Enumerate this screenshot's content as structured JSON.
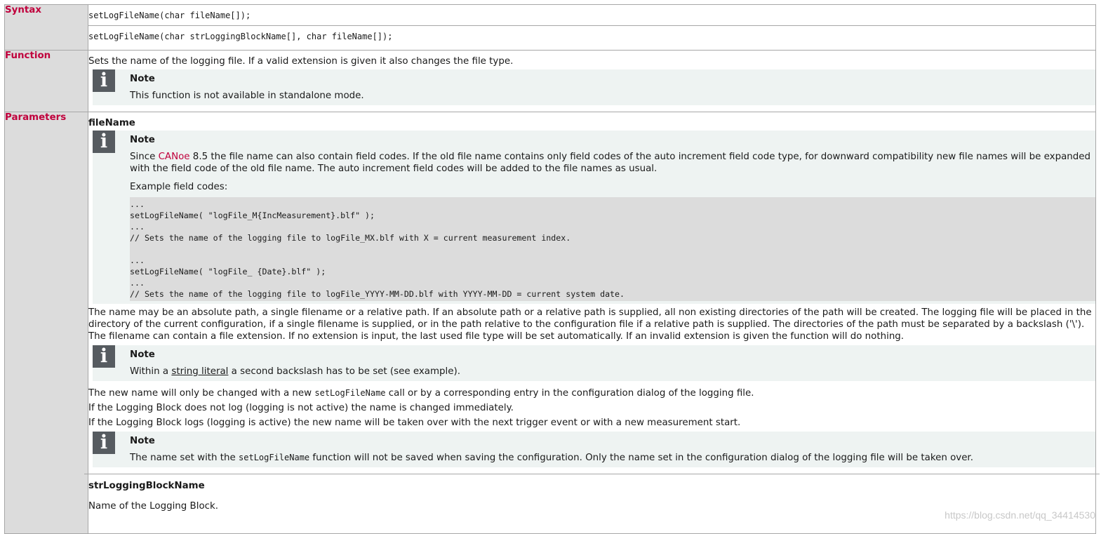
{
  "rows": {
    "syntax": {
      "label": "Syntax",
      "line1": "setLogFileName(char fileName[]);",
      "line2": "setLogFileName(char strLoggingBlockName[], char fileName[]);"
    },
    "function": {
      "label": "Function",
      "text": "Sets the name of the logging file. If a valid extension is given it also changes the file type.",
      "note_title": "Note",
      "note_text": "This function is not available in standalone mode."
    },
    "parameters": {
      "label": "Parameters",
      "param1_name": "fileName",
      "note1_title": "Note",
      "note1_text_prefix": "Since ",
      "note1_canoe": "CANoe",
      "note1_text_suffix": " 8.5 the file name can also contain field codes. If the old file name contains only field codes of the auto increment field code type, for downward compatibility new file names will be expanded with the field code of the old file name. The auto increment field codes will be added to the file names as usual.",
      "note1_example_label": "Example field codes:",
      "code_lines": [
        "...",
        "setLogFileName( \"logFile_M{IncMeasurement}.blf\" );",
        "...",
        "// Sets the name of the logging file to logFile_MX.blf with X = current measurement index.",
        "",
        "...",
        "setLogFileName( \"logFile_ {Date}.blf\" );",
        "...",
        "// Sets the name of the logging file to logFile_YYYY-MM-DD.blf with YYYY-MM-DD = current system date."
      ],
      "path_text": "The name may be an absolute path, a single filename or a relative path. If an absolute path or a relative path is supplied, all non existing directories of the path will be created. The logging file will be placed in the directory of the current configuration, if a single filename is supplied, or in the path relative to the configuration file if a relative path is supplied. The directories of the path must be separated by a backslash ('\\'). The filename can contain a file extension. If no extension is input, the last used file type will be set automatically. If an invalid extension is given the function will do nothing.",
      "note2_title": "Note",
      "note2_prefix": "Within a ",
      "note2_link": "string literal",
      "note2_suffix": " a second backslash has to be set (see example).",
      "change_prefix": "The new name will only be changed with a new ",
      "change_code": "setLogFileName",
      "change_suffix": " call or by a corresponding entry in the configuration dialog of the logging file.",
      "not_active_text": "If the Logging Block does not log (logging is not active) the name is changed immediately.",
      "active_text": "If the Logging Block logs (logging is active) the new name will be taken over with the next trigger event or with a new measurement start.",
      "note3_title": "Note",
      "note3_prefix": "The name set with the ",
      "note3_code": "setLogFileName",
      "note3_suffix": " function will not be saved when saving the configuration. Only the name set in the configuration dialog of the logging file will be taken over.",
      "param2_name": "strLoggingBlockName",
      "param2_desc": "Name of the Logging Block."
    }
  },
  "icons": {
    "info": "i"
  },
  "watermark": "https://blog.csdn.net/qq_34414530",
  "colors": {
    "accent": "#c0003c",
    "label_bg": "#dcdcdc",
    "note_bg": "#eef3f2",
    "icon_bg": "#565b60"
  }
}
